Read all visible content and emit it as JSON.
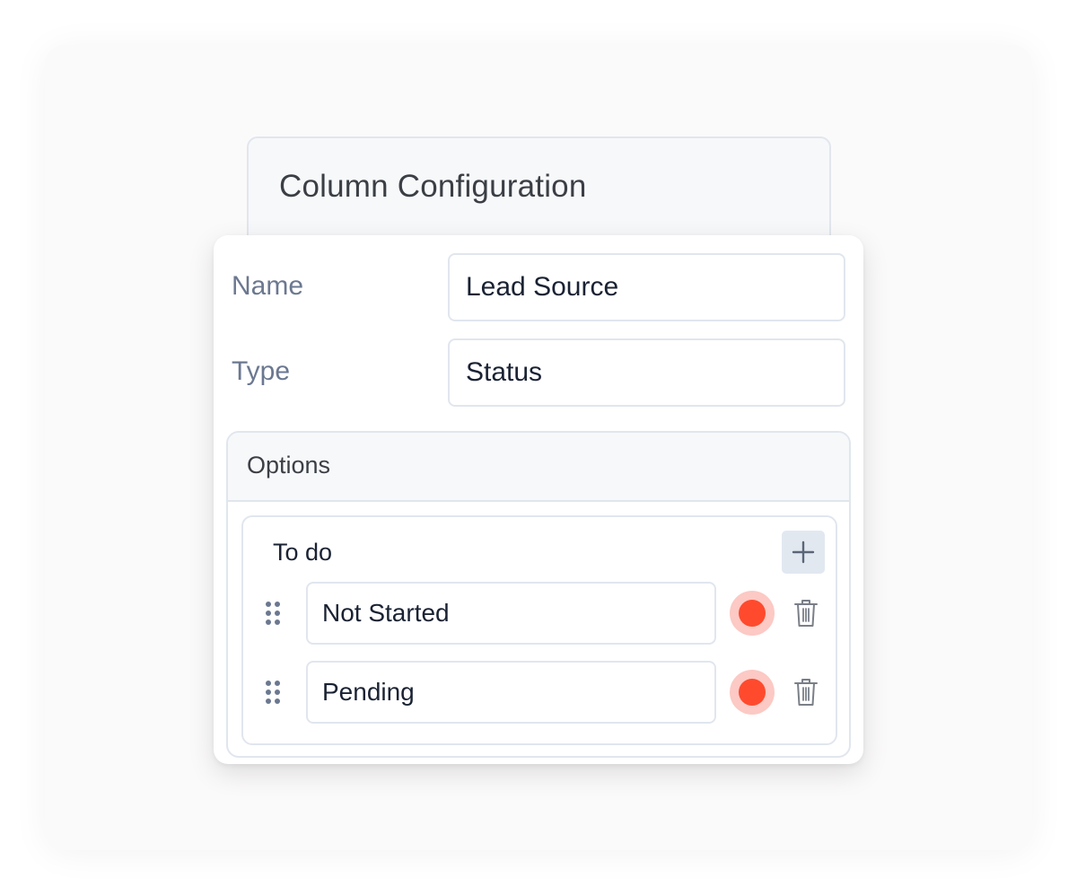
{
  "dialog": {
    "title": "Column Configuration"
  },
  "fields": {
    "name": {
      "label": "Name",
      "value": "Lead Source"
    },
    "type": {
      "label": "Type",
      "value": "Status"
    }
  },
  "options": {
    "header": "Options",
    "group": {
      "title": "To do",
      "add_icon": "plus-icon",
      "items": [
        {
          "value": "Not Started",
          "color": "#ff4a2e"
        },
        {
          "value": "Pending",
          "color": "#ff4a2e"
        }
      ]
    }
  },
  "icons": {
    "drag": "drag-handle-icon",
    "delete": "trash-icon"
  },
  "colors": {
    "dot_ring": "#fcc9c4",
    "border": "#e1e6ee",
    "label": "#6b7890"
  }
}
